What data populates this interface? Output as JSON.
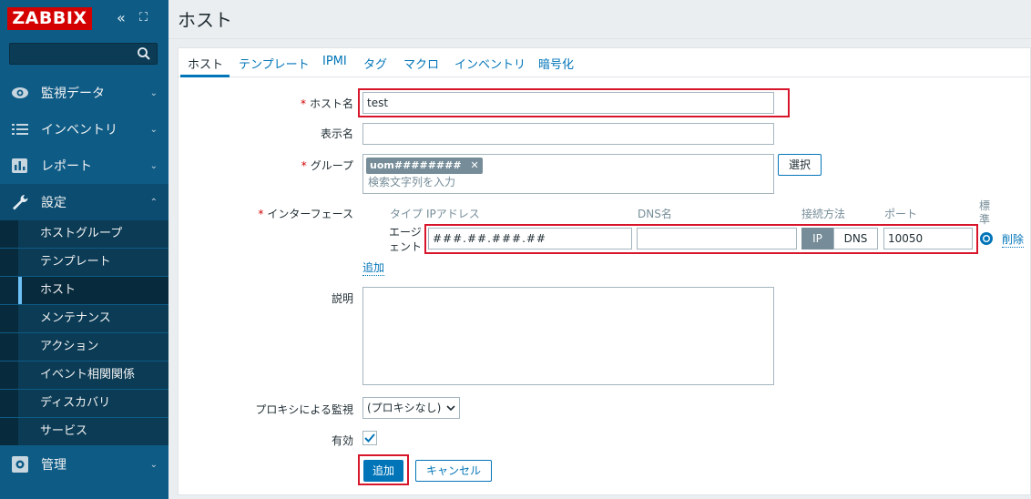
{
  "sidebar": {
    "logo": "ZABBIX",
    "collapse_glyph": "«",
    "kiosk_glyph": "⛶",
    "search_placeholder": "",
    "sections": [
      {
        "label": "監視データ",
        "icon": "eye-icon"
      },
      {
        "label": "インベントリ",
        "icon": "list-icon"
      },
      {
        "label": "レポート",
        "icon": "bar-chart-icon"
      },
      {
        "label": "設定",
        "icon": "wrench-icon"
      },
      {
        "label": "管理",
        "icon": "gear-icon"
      }
    ],
    "submenu": [
      "ホストグループ",
      "テンプレート",
      "ホスト",
      "メンテナンス",
      "アクション",
      "イベント相関関係",
      "ディスカバリ",
      "サービス"
    ],
    "active_submenu": "ホスト"
  },
  "page": {
    "title": "ホスト"
  },
  "tabs": [
    "ホスト",
    "テンプレート",
    "IPMI",
    "タグ",
    "マクロ",
    "インベントリ",
    "暗号化"
  ],
  "form": {
    "hostname_label": "ホスト名",
    "hostname_value": "test",
    "visible_name_label": "表示名",
    "visible_name_value": "",
    "groups_label": "グループ",
    "group_chip": "uom########",
    "group_chip_remove": "✕",
    "groups_search_placeholder": "検索文字列を入力",
    "select_button": "選択",
    "interfaces_label": "インターフェース",
    "iface_headers": {
      "type": "タイプ",
      "ip": "IPアドレス",
      "dns": "DNS名",
      "connect": "接続方法",
      "port": "ポート",
      "default": "標準"
    },
    "iface_type": "エージェント",
    "iface_ip": "###.##.###.##",
    "iface_dns": "",
    "iface_connect_ip": "IP",
    "iface_connect_dns": "DNS",
    "iface_port": "10050",
    "iface_remove": "削除",
    "add_link": "追加",
    "description_label": "説明",
    "description_value": "",
    "proxy_label": "プロキシによる監視",
    "proxy_value": "(プロキシなし)",
    "enabled_label": "有効",
    "enabled": true,
    "add_button": "追加",
    "cancel_button": "キャンセル"
  },
  "colors": {
    "sidebar": "#0e5b86",
    "accent": "#0275b8",
    "highlight": "#d7162b",
    "logo": "#d40000"
  }
}
